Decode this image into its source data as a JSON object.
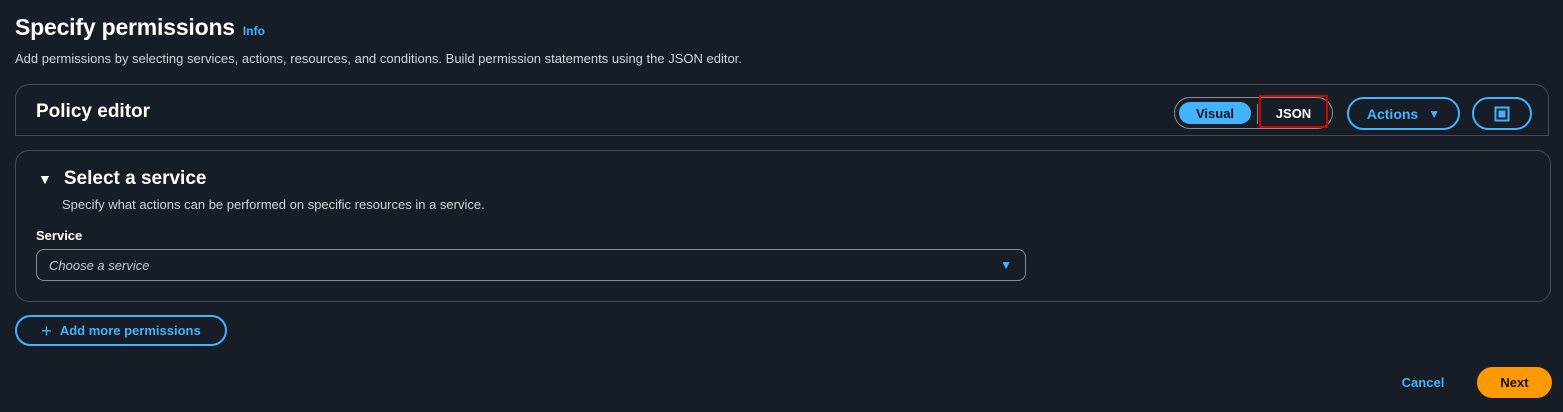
{
  "header": {
    "title": "Specify permissions",
    "info_label": "Info",
    "description": "Add permissions by selecting services, actions, resources, and conditions. Build permission statements using the JSON editor."
  },
  "policy_editor": {
    "title": "Policy editor",
    "mode_toggle": {
      "visual_label": "Visual",
      "json_label": "JSON",
      "selected": "Visual"
    },
    "actions_label": "Actions",
    "actions_icon": "caret-down-icon",
    "fullscreen_icon": "fullscreen-icon"
  },
  "service_section": {
    "title": "Select a service",
    "description": "Specify what actions can be performed on specific resources in a service.",
    "service_label": "Service",
    "service_placeholder": "Choose a service"
  },
  "add_permissions_label": "Add more permissions",
  "footer": {
    "cancel_label": "Cancel",
    "next_label": "Next"
  },
  "colors": {
    "background": "#161d26",
    "accent": "#42b4ff",
    "primary_button": "#ff9900",
    "border": "#414d5c",
    "highlight": "#d40000"
  }
}
